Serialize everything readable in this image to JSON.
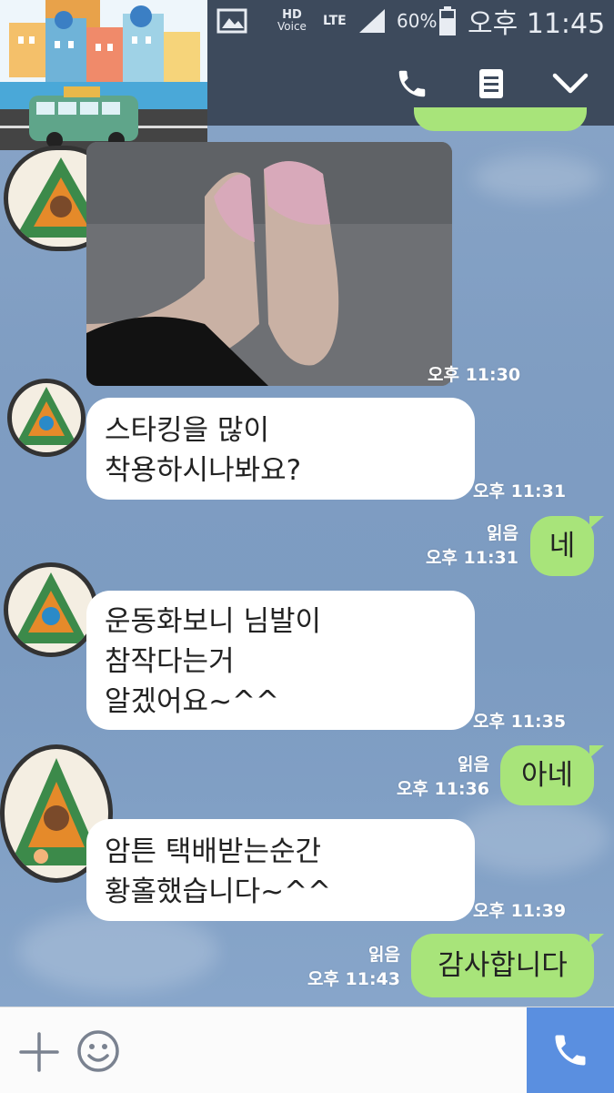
{
  "status_bar": {
    "hd": "HD",
    "voice": "Voice",
    "network": "LTE",
    "battery_percent": "60%",
    "time": "오후 11:45"
  },
  "header": {
    "icons": [
      "phone-icon",
      "menu-list-icon",
      "chevron-down-icon"
    ]
  },
  "messages": [
    {
      "type": "image",
      "direction": "in",
      "time": "오후 11:30"
    },
    {
      "type": "text",
      "direction": "in",
      "lines": [
        "스타킹을 많이",
        "착용하시나봐요?"
      ],
      "time": "오후 11:31"
    },
    {
      "type": "text",
      "direction": "out",
      "text": "네",
      "read": "읽음",
      "time": "오후 11:31"
    },
    {
      "type": "text",
      "direction": "in",
      "lines": [
        "운동화보니 님발이",
        "참작다는거",
        "알겠어요~^^"
      ],
      "time": "오후 11:35"
    },
    {
      "type": "text",
      "direction": "out",
      "text": "아네",
      "read": "읽음",
      "time": "오후 11:36"
    },
    {
      "type": "text",
      "direction": "in",
      "lines": [
        "암튼 택배받는순간",
        "황홀했습니다~^^"
      ],
      "time": "오후 11:39"
    },
    {
      "type": "text",
      "direction": "out",
      "text": "감사합니다",
      "read": "읽음",
      "time": "오후 11:43"
    }
  ],
  "input_bar": {
    "icons": [
      "plus-icon",
      "emoji-icon",
      "call-icon"
    ]
  },
  "colors": {
    "bar": "#3d4a5c",
    "chat_bg": "#7f9dc2",
    "bubble_out": "#a8e47a",
    "bubble_in": "#ffffff",
    "call_button": "#5a8fe0"
  }
}
